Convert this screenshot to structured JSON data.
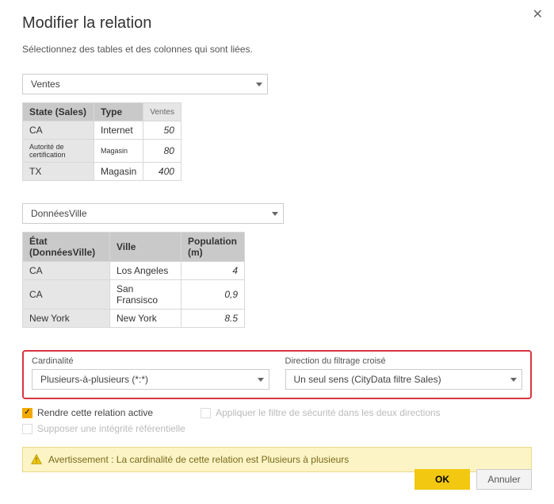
{
  "dialog": {
    "title": "Modifier la relation",
    "subtitle": "Sélectionnez des tables et des colonnes qui sont liées."
  },
  "table1": {
    "selected": "Ventes",
    "headers": {
      "c0": "State (Sales)",
      "c1": "Type",
      "c2": "Ventes"
    },
    "rows": [
      {
        "c0": "CA",
        "c1": "Internet",
        "c2": "50"
      },
      {
        "c0": "Autorité de certification",
        "c1": "Magasin",
        "c2": "80"
      },
      {
        "c0": "TX",
        "c1": "Magasin",
        "c2": "400"
      }
    ]
  },
  "table2": {
    "selected": "DonnéesVille",
    "headers": {
      "c0": "État (DonnéesVille)",
      "c1": "Ville",
      "c2": "Population (m)"
    },
    "rows": [
      {
        "c0": "CA",
        "c1": "Los Angeles",
        "c2": "4"
      },
      {
        "c0": "CA",
        "c1": "San Fransisco",
        "c2": "0,9"
      },
      {
        "c0": "New York",
        "c1": "New York",
        "c2": "8.5"
      }
    ]
  },
  "cardinality": {
    "label": "Cardinalité",
    "value": "Plusieurs-à-plusieurs (*:*)"
  },
  "crossfilter": {
    "label": "Direction du filtrage croisé",
    "value": "Un seul sens (CityData filtre Sales)"
  },
  "checks": {
    "active": "Rendre cette relation active",
    "security": "Appliquer le filtre de sécurité dans les deux directions",
    "integrity": "Supposer une intégrité référentielle"
  },
  "warning": "Avertissement : La cardinalité de cette relation est Plusieurs à plusieurs",
  "buttons": {
    "ok": "OK",
    "cancel": "Annuler"
  }
}
